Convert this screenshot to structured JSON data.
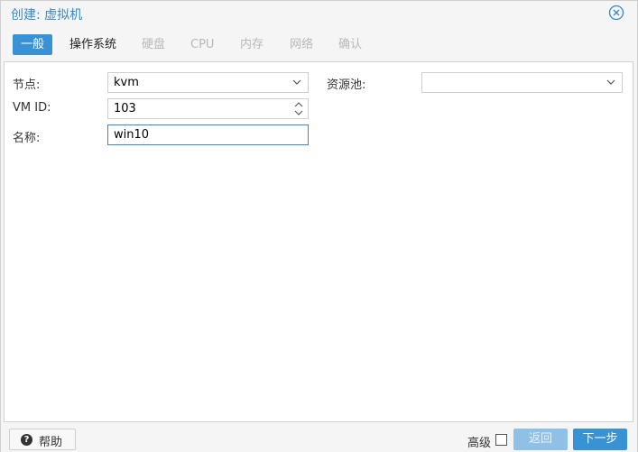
{
  "window": {
    "title": "创建: 虚拟机"
  },
  "tabs": [
    {
      "label": "一般",
      "state": "active"
    },
    {
      "label": "操作系统",
      "state": "normal"
    },
    {
      "label": "硬盘",
      "state": "disabled"
    },
    {
      "label": "CPU",
      "state": "disabled"
    },
    {
      "label": "内存",
      "state": "disabled"
    },
    {
      "label": "网络",
      "state": "disabled"
    },
    {
      "label": "确认",
      "state": "disabled"
    }
  ],
  "form": {
    "node_label": "节点:",
    "node_value": "kvm",
    "vmid_label": "VM ID:",
    "vmid_value": "103",
    "name_label": "名称:",
    "name_value": "win10",
    "pool_label": "资源池:",
    "pool_value": ""
  },
  "footer": {
    "help_label": "帮助",
    "advanced_label": "高级",
    "back_label": "返回",
    "next_label": "下一步"
  },
  "colors": {
    "accent": "#3892d4",
    "title": "#3a87c8",
    "disabled_tab": "#b8b8b8",
    "back_disabled": "#8fc0e6"
  }
}
